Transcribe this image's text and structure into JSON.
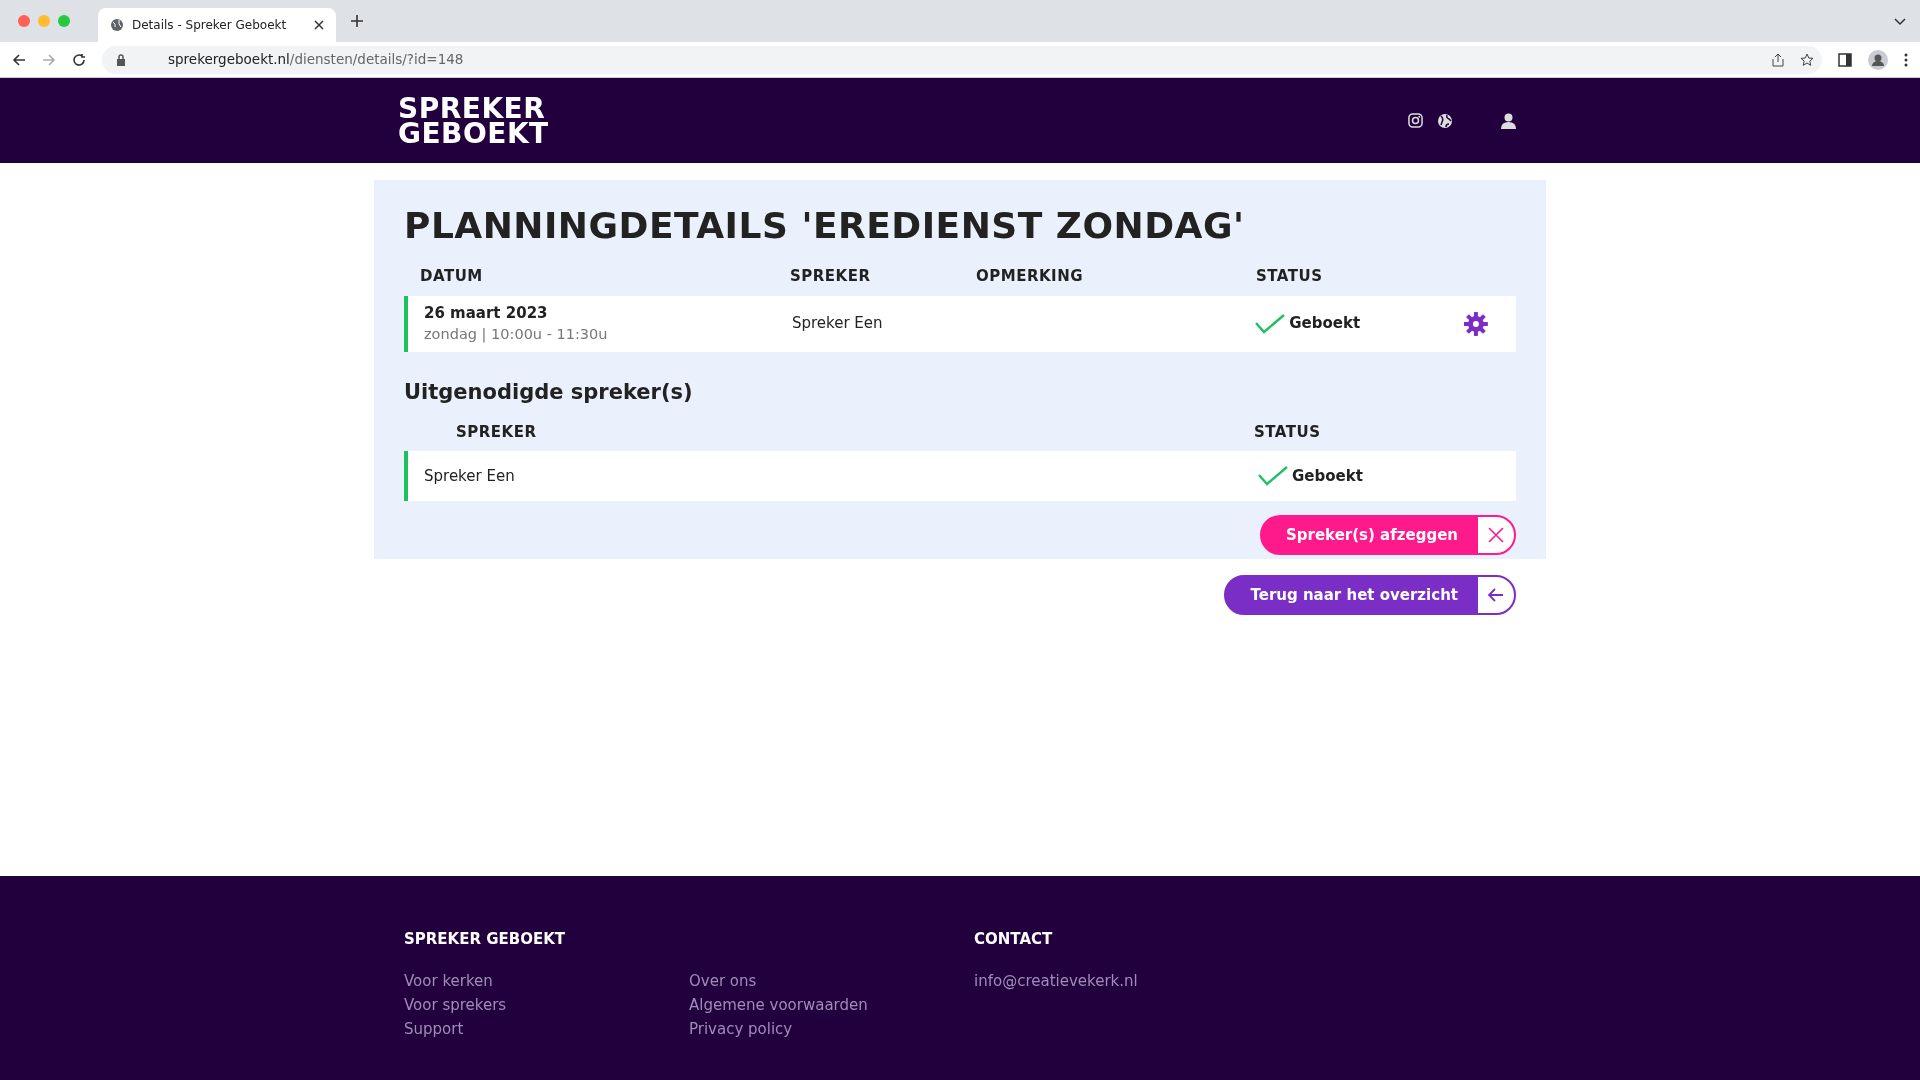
{
  "browser": {
    "tab_title": "Details - Spreker Geboekt",
    "url_host": "sprekergeboekt.nl",
    "url_path": "/diensten/details/?id=148"
  },
  "header": {
    "logo_lines": [
      "SPREKER",
      "GEBOEKT"
    ]
  },
  "title": "PLANNINGDETAILS 'EREDIENST ZONDAG'",
  "planning": {
    "columns": [
      "DATUM",
      "SPREKER",
      "OPMERKING",
      "STATUS"
    ],
    "rows": [
      {
        "date": "26 maart 2023",
        "time": "zondag | 10:00u - 11:30u",
        "speaker": "Spreker Een",
        "status": "Geboekt"
      }
    ]
  },
  "invited": {
    "heading": "Uitgenodigde spreker(s)",
    "columns": [
      "SPREKER",
      "STATUS"
    ],
    "rows": [
      {
        "speaker": "Spreker Een",
        "status": "Geboekt"
      }
    ]
  },
  "cancel_button": "Spreker(s) afzeggen",
  "back_button": "Terug naar het overzicht",
  "footer": {
    "brand_heading": "SPREKER GEBOEKT",
    "links_col1": [
      "Voor kerken",
      "Voor sprekers",
      "Support"
    ],
    "links_col2": [
      "Over ons",
      "Algemene voorwaarden",
      "Privacy policy"
    ],
    "contact_heading": "CONTACT",
    "contact_links": [
      "info@creatievekerk.nl"
    ]
  }
}
